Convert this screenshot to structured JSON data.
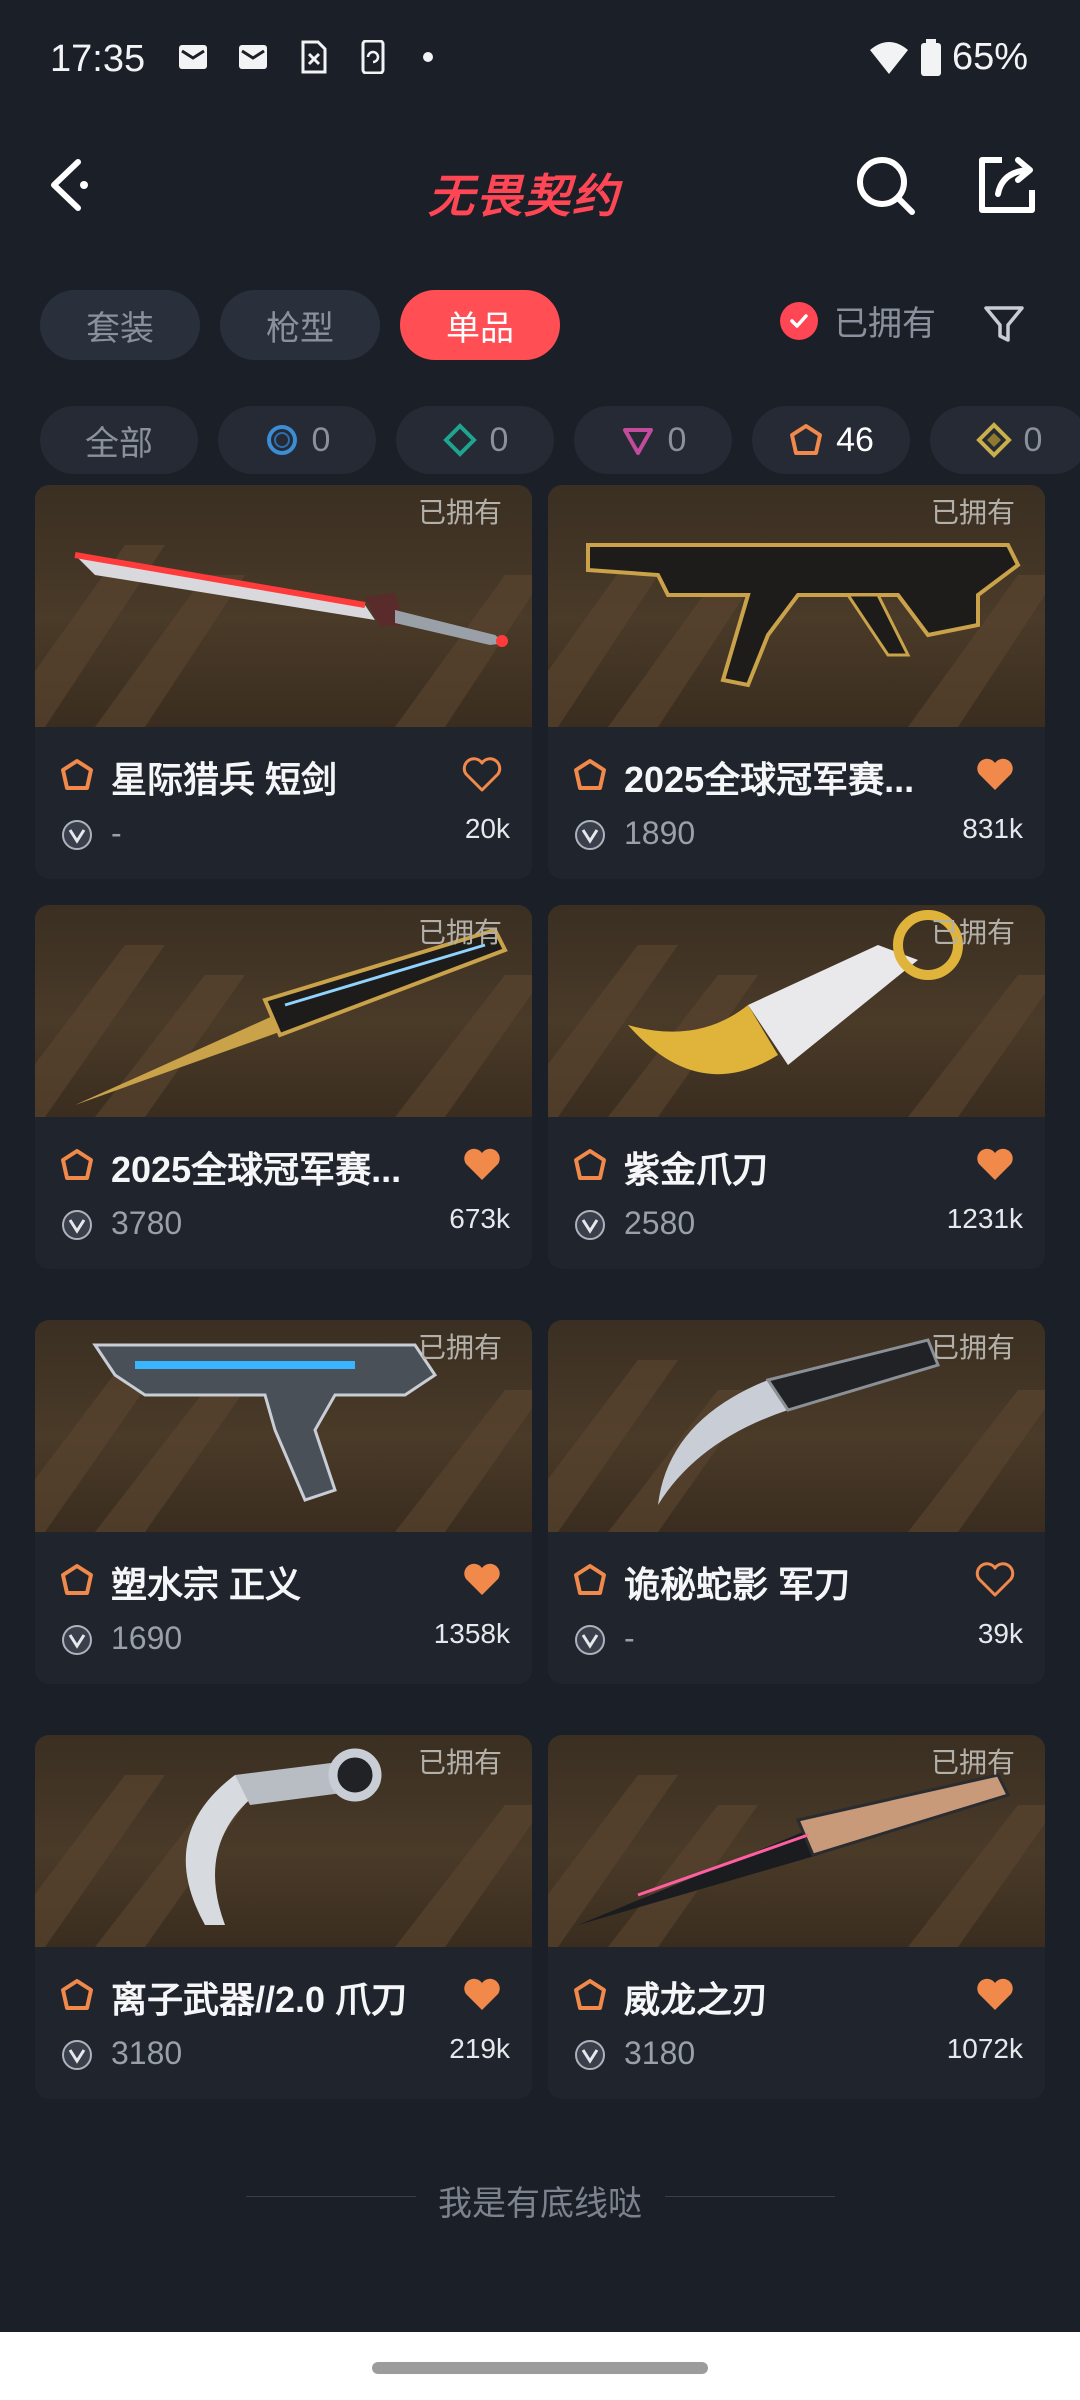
{
  "status_bar": {
    "time": "17:35",
    "battery": "65%",
    "icons": [
      "mail-icon",
      "mail-icon",
      "sim-off-icon",
      "phone-sync-icon",
      "dot-icon"
    ]
  },
  "header": {
    "title": "无畏契约",
    "accent_color": "#ff4655"
  },
  "tabs": [
    {
      "label": "套装",
      "active": false
    },
    {
      "label": "枪型",
      "active": false
    },
    {
      "label": "单品",
      "active": true
    }
  ],
  "owned_filter": {
    "label": "已拥有",
    "checked": true
  },
  "tiers": [
    {
      "label": "全部",
      "count": ""
    },
    {
      "icon": "select-tier-icon",
      "count": "0",
      "color": "#3b8dd6"
    },
    {
      "icon": "deluxe-tier-icon",
      "count": "0",
      "color": "#1fa58f"
    },
    {
      "icon": "premium-tier-icon",
      "count": "0",
      "color": "#c44a9b"
    },
    {
      "icon": "exclusive-tier-icon",
      "count": "46",
      "color": "#f0894a"
    },
    {
      "icon": "ultra-tier-icon",
      "count": "0",
      "color": "#c9b04a"
    }
  ],
  "items": [
    {
      "name": "星际猎兵 短剑",
      "price": "-",
      "likes": "20k",
      "owned_label": "已拥有",
      "liked": false
    },
    {
      "name": "2025全球冠军赛...",
      "price": "1890",
      "likes": "831k",
      "owned_label": "已拥有",
      "liked": true
    },
    {
      "name": "2025全球冠军赛...",
      "price": "3780",
      "likes": "673k",
      "owned_label": "已拥有",
      "liked": true
    },
    {
      "name": "紫金爪刀",
      "price": "2580",
      "likes": "1231k",
      "owned_label": "已拥有",
      "liked": true
    },
    {
      "name": "塑水宗 正义",
      "price": "1690",
      "likes": "1358k",
      "owned_label": "已拥有",
      "liked": true
    },
    {
      "name": "诡秘蛇影 军刀",
      "price": "-",
      "likes": "39k",
      "owned_label": "已拥有",
      "liked": false
    },
    {
      "name": "离子武器//2.0 爪刀",
      "price": "3180",
      "likes": "219k",
      "owned_label": "已拥有",
      "liked": true
    },
    {
      "name": "威龙之刃",
      "price": "3180",
      "likes": "1072k",
      "owned_label": "已拥有",
      "liked": true
    }
  ],
  "footer": {
    "text": "我是有底线哒"
  }
}
